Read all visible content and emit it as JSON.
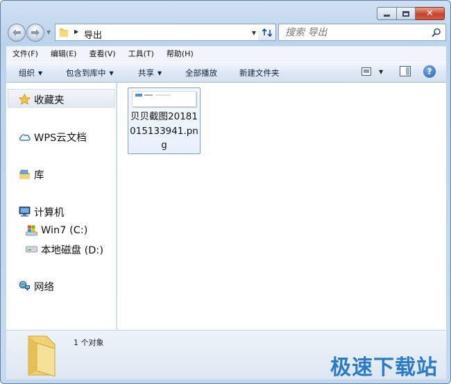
{
  "window": {
    "minimize_icon": "minimize-icon",
    "maximize_icon": "maximize-icon",
    "close_glyph": "✕"
  },
  "navigation": {
    "back_icon": "back-arrow-icon",
    "forward_icon": "forward-arrow-icon"
  },
  "address_bar": {
    "path": "导出",
    "folder_icon": "folder-icon"
  },
  "search": {
    "placeholder": "搜索 导出"
  },
  "menu": {
    "items": [
      "文件(F)",
      "编辑(E)",
      "查看(V)",
      "工具(T)",
      "帮助(H)"
    ]
  },
  "toolbar": {
    "organize": "组织",
    "include_in_library": "包含到库中",
    "share": "共享",
    "play_all": "全部播放",
    "new_folder": "新建文件夹",
    "help_glyph": "?"
  },
  "nav_pane": {
    "favorites": "收藏夹",
    "wps_cloud": "WPS云文档",
    "libraries": "库",
    "computer": "计算机",
    "drive_c": "Win7 (C:)",
    "drive_d": "本地磁盘 (D:)",
    "network": "网络"
  },
  "files": [
    {
      "name": "贝贝截图20181015133941.png",
      "icon": "png-thumbnail"
    }
  ],
  "details": {
    "item_count": "1 个对象"
  },
  "watermark": {
    "text": "极速下载站"
  },
  "colors": {
    "selection_border": "#7da2ce",
    "watermark": "#2b79c9",
    "close_button": "#c9432b"
  }
}
